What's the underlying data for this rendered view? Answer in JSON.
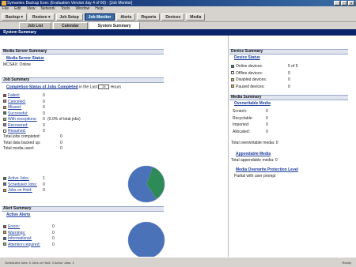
{
  "window": {
    "title": "Symantec Backup Exec (Evaluation Version day 4 of 60) - [Job Monitor]",
    "buttons": [
      "_",
      "□",
      "×"
    ]
  },
  "menubar": {
    "items": [
      "File",
      "Edit",
      "View",
      "Network",
      "Tools",
      "Window",
      "Help"
    ]
  },
  "toolbar": {
    "buttons": [
      "Backup ▾",
      "Restore ▾",
      "Job Setup",
      "Job Monitor",
      "Alerts",
      "Reports",
      "Devices",
      "Media"
    ]
  },
  "subtabs": [
    "Job List",
    "Calendar",
    "System Summary"
  ],
  "page_title": "System Summary",
  "media_server": {
    "header": "Media Server Summary",
    "link": "Media Server Status",
    "server_line": "MCSAX: Online"
  },
  "job_summary": {
    "header": "Job Summary",
    "completion_link": "Completion Status of Jobs Completed",
    "in_the_last": "in the Last",
    "hours_value": "24",
    "hours_label": "Hours",
    "statuses": [
      {
        "label": "Failed:",
        "value": "0",
        "color": "#c0392b"
      },
      {
        "label": "Canceled:",
        "value": "0",
        "color": "#d46a6a"
      },
      {
        "label": "Missed:",
        "value": "0",
        "color": "#e0a030"
      },
      {
        "label": "Successful:",
        "value": "0",
        "color": "#2e8b57"
      },
      {
        "label": "With exceptions:",
        "value": "0",
        "color": "#8fbc5a"
      },
      {
        "label": "Recovered:",
        "value": "0",
        "color": "#9b6cc8"
      },
      {
        "label": "Resumed:",
        "value": "0",
        "color": "#ffffff"
      }
    ],
    "successful_pct": "(0.0% of total jobs)",
    "totals": [
      {
        "label": "Total jobs completed:",
        "value": "0"
      },
      {
        "label": "Total data backed up:",
        "value": "0"
      },
      {
        "label": "Total media used:",
        "value": "0"
      }
    ],
    "active": [
      {
        "label": "Active Jobs:",
        "value": "1",
        "color": "#2e8b57"
      },
      {
        "label": "Scheduled Jobs:",
        "value": "0",
        "color": "#3a66b0"
      },
      {
        "label": "Jobs on Hold:",
        "value": "0",
        "color": "#e0a030"
      }
    ]
  },
  "alert_summary": {
    "header": "Alert Summary",
    "link": "Active Alerts",
    "items": [
      {
        "label": "Errors:",
        "value": "0",
        "color": "#c0392b"
      },
      {
        "label": "Warnings:",
        "value": "0",
        "color": "#e0a030"
      },
      {
        "label": "Informational:",
        "value": "0",
        "color": "#3a66b0"
      },
      {
        "label": "Attention required:",
        "value": "0",
        "color": "#8fbc5a"
      }
    ]
  },
  "device_summary": {
    "header": "Device Summary",
    "link": "Device Status",
    "items": [
      {
        "label": "Online devices:",
        "value": "5 of 5",
        "color": "#2e8b57"
      },
      {
        "label": "Offline devices:",
        "value": "0",
        "color": "#ffffff"
      },
      {
        "label": "Disabled devices:",
        "value": "0",
        "color": "#e0c040"
      },
      {
        "label": "Paused devices:",
        "value": "0",
        "color": "#e0c040"
      }
    ]
  },
  "media_summary": {
    "header": "Media Summary",
    "overwritable_link": "Overwritable Media",
    "overwritable": [
      {
        "label": "Scratch:",
        "value": "0"
      },
      {
        "label": "Recyclable:",
        "value": "0"
      },
      {
        "label": "Imported:",
        "value": "0"
      },
      {
        "label": "Allocated:",
        "value": "0"
      }
    ],
    "total_overwritable": "Total overwritable media:  0",
    "appendable_link": "Appendable Media",
    "total_appendable": "Total appendable media:  0",
    "protection_link": "Media Overwrite Protection Level",
    "protection_value": "Partial with user prompt"
  },
  "chart_data": [
    {
      "type": "pie",
      "categories": [
        "Active Jobs",
        "Scheduled Jobs",
        "Jobs on Hold"
      ],
      "values": [
        0.35,
        0.65,
        0
      ],
      "colors": [
        "#2e8b57",
        "#4a72b8",
        "#e0a030"
      ]
    },
    {
      "type": "pie",
      "categories": [
        "Errors",
        "Warnings",
        "Informational",
        "Attention required"
      ],
      "values": [
        0,
        0,
        1,
        0
      ],
      "colors": [
        "#c0392b",
        "#e0a030",
        "#4a72b8",
        "#8fbc5a"
      ]
    }
  ],
  "statusbar": {
    "left": "Scheduled Jobs: 0  Jobs on Hold: 0  Active Jobs: 1",
    "right": "Ready"
  }
}
